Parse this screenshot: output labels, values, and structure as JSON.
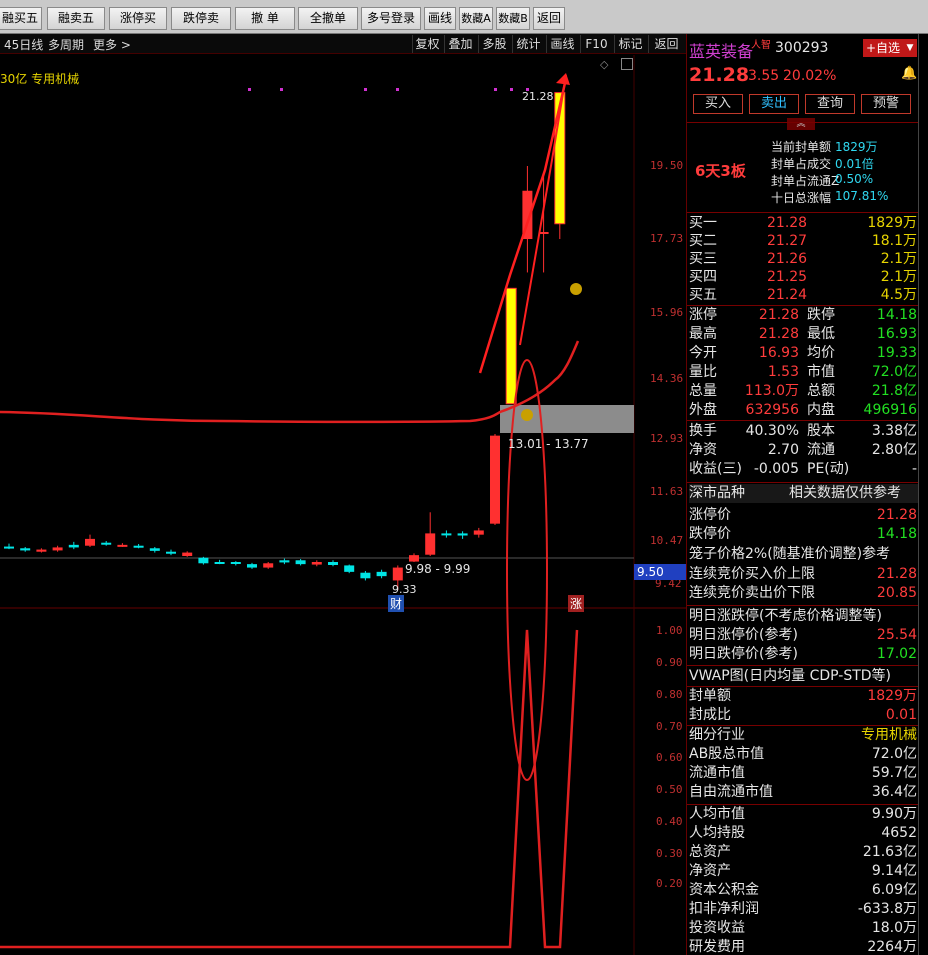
{
  "toolbar": {
    "buttons": [
      "融买五",
      "融卖五",
      "涨停买",
      "跌停卖",
      "撤 单",
      "全撤单",
      "多号登录",
      "画线",
      "数藏A",
      "数藏B",
      "返回"
    ]
  },
  "subbar": {
    "left": [
      "45日线",
      "多周期",
      "更多 >"
    ],
    "right": [
      "复权",
      "叠加",
      "多股",
      "统计",
      "画线",
      "F10",
      "标记",
      "返回"
    ]
  },
  "chart": {
    "industry_label": "30亿 专用机械",
    "y_ticks": [
      "19.50",
      "17.73",
      "15.96",
      "14.36",
      "12.93",
      "11.63",
      "10.47",
      "9.42"
    ],
    "lower_ticks": [
      "1.00",
      "0.90",
      "0.80",
      "0.70",
      "0.60",
      "0.50",
      "0.40",
      "0.30",
      "0.20"
    ],
    "high_label": "21.28",
    "gap_label": "13.01 - 13.77",
    "gap2_label": "9.98 - 9.99",
    "low_label": "9.33",
    "cur_price_tag": "9.50",
    "cai_tag": "财",
    "zhang_tag": "涨"
  },
  "quote": {
    "name": "蓝英装备",
    "tag": "人智",
    "code": "300293",
    "add_btn": "+自选",
    "price": "21.28",
    "change": "3.55",
    "pct": "20.02%",
    "actions": [
      "买入",
      "卖出",
      "查询",
      "预警"
    ],
    "streak": "6天3板",
    "seal": [
      {
        "label": "当前封单额",
        "val": "1829万"
      },
      {
        "label": "封单占成交",
        "val": "0.01倍"
      },
      {
        "label": "封单占流通Z",
        "val": "0.50%"
      },
      {
        "label": "十日总涨幅",
        "val": "107.81%"
      }
    ],
    "bids": [
      {
        "k": "买一",
        "p": "21.28",
        "v": "1829万"
      },
      {
        "k": "买二",
        "p": "21.27",
        "v": "18.1万"
      },
      {
        "k": "买三",
        "p": "21.26",
        "v": "2.1万"
      },
      {
        "k": "买四",
        "p": "21.25",
        "v": "2.1万"
      },
      {
        "k": "买五",
        "p": "21.24",
        "v": "4.5万"
      }
    ],
    "stats": [
      {
        "a": "涨停",
        "av": "21.28",
        "b": "跌停",
        "bv": "14.18"
      },
      {
        "a": "最高",
        "av": "21.28",
        "b": "最低",
        "bv": "16.93"
      },
      {
        "a": "今开",
        "av": "16.93",
        "b": "均价",
        "bv": "19.33"
      },
      {
        "a": "量比",
        "av": "1.53",
        "b": "市值",
        "bv": "72.0亿"
      },
      {
        "a": "总量",
        "av": "113.0万",
        "b": "总额",
        "bv": "21.8亿"
      },
      {
        "a": "外盘",
        "av": "632956",
        "b": "内盘",
        "bv": "496916"
      }
    ],
    "stats2": [
      {
        "a": "换手",
        "av": "40.30%",
        "b": "股本",
        "bv": "3.38亿"
      },
      {
        "a": "净资",
        "av": "2.70",
        "b": "流通",
        "bv": "2.80亿"
      },
      {
        "a": "收益(三)",
        "av": "-0.005",
        "b": "PE(动)",
        "bv": "-"
      }
    ],
    "market_title": "深市品种",
    "market_note": "相关数据仅供参考",
    "limits": [
      {
        "k": "涨停价",
        "v": "21.28"
      },
      {
        "k": "跌停价",
        "v": "14.18"
      }
    ],
    "cage_title": "笼子价格2%(随基准价调整)参考",
    "cage": [
      {
        "k": "连续竞价买入价上限",
        "v": "21.28"
      },
      {
        "k": "连续竞价卖出价下限",
        "v": "20.85"
      }
    ],
    "tomorrow_title": "明日涨跌停(不考虑价格调整等)",
    "tomorrow": [
      {
        "k": "明日涨停价(参考)",
        "v": "25.54"
      },
      {
        "k": "明日跌停价(参考)",
        "v": "17.02"
      }
    ],
    "vwap_title": "VWAP图(日内均量 CDP-STD等)",
    "fund": [
      {
        "k": "封单额",
        "v": "1829万"
      },
      {
        "k": "封成比",
        "v": "0.01"
      }
    ],
    "info": [
      {
        "k": "细分行业",
        "v": "专用机械"
      },
      {
        "k": "AB股总市值",
        "v": "72.0亿"
      },
      {
        "k": "流通市值",
        "v": "59.7亿"
      },
      {
        "k": "自由流通市值",
        "v": "36.4亿"
      }
    ],
    "info2": [
      {
        "k": "人均市值",
        "v": "9.90万"
      },
      {
        "k": "人均持股",
        "v": "4652"
      },
      {
        "k": "总资产",
        "v": "21.63亿"
      },
      {
        "k": "净资产",
        "v": "9.14亿"
      },
      {
        "k": "资本公积金",
        "v": "6.09亿"
      },
      {
        "k": "扣非净利润",
        "v": "-633.8万"
      },
      {
        "k": "投资收益",
        "v": "18.0万"
      },
      {
        "k": "研发费用",
        "v": "2264万"
      }
    ]
  },
  "colors": {
    "up": "#ff3c3c",
    "down": "#22e022",
    "accent": "#ffff00",
    "ma": "#e02020"
  }
}
